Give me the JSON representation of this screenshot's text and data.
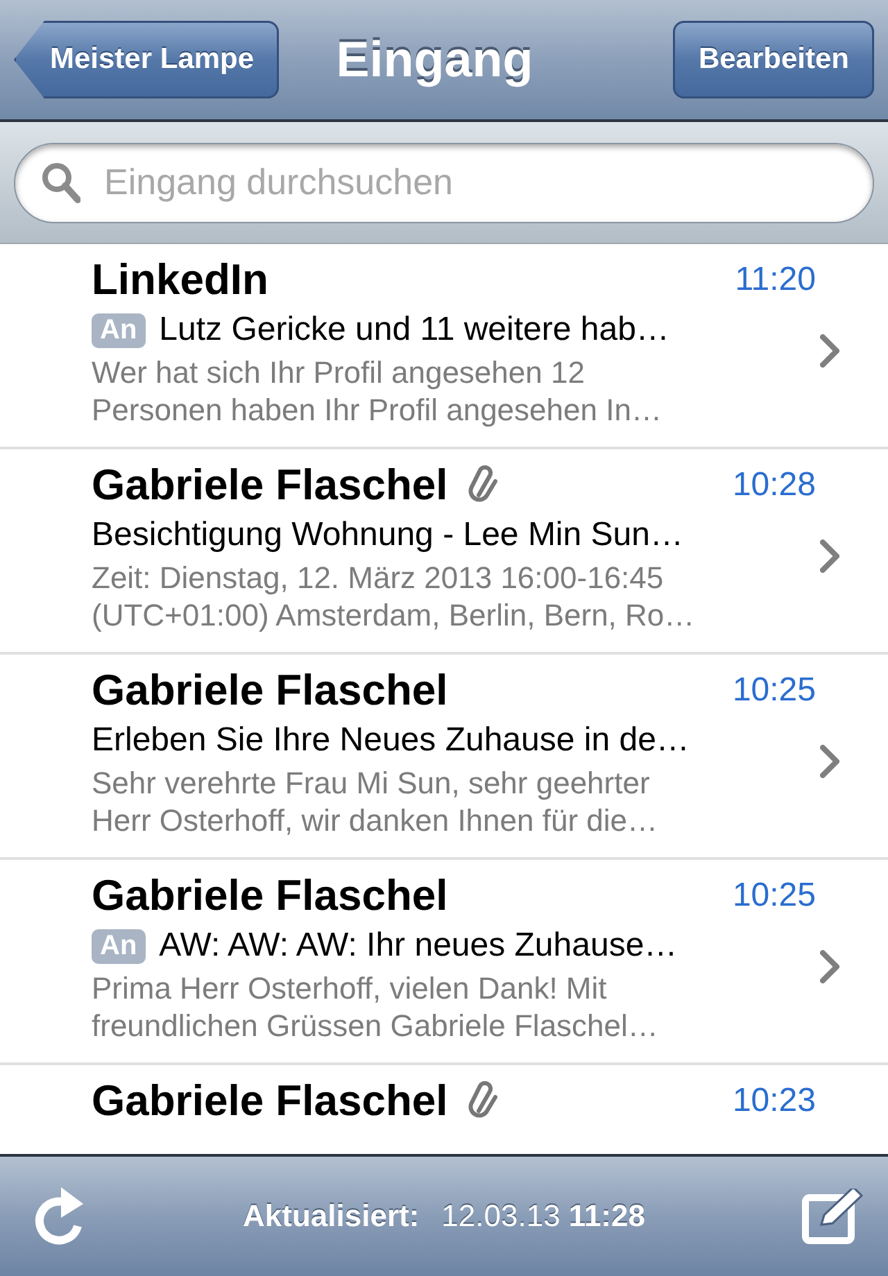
{
  "nav": {
    "back": "Meister Lampe",
    "title": "Eingang",
    "edit": "Bearbeiten"
  },
  "search": {
    "placeholder": "Eingang durchsuchen"
  },
  "messages": [
    {
      "sender": "LinkedIn",
      "time": "11:20",
      "attachment": false,
      "badge": "An",
      "subject": "Lutz Gericke und 11 weitere hab…",
      "preview": "Wer hat sich Ihr Profil angesehen 12 Personen haben Ihr Profil angesehen In…"
    },
    {
      "sender": "Gabriele Flaschel",
      "time": "10:28",
      "attachment": true,
      "subject": "Besichtigung Wohnung - Lee Min Sun…",
      "preview": "Zeit: Dienstag, 12. März 2013 16:00-16:45 (UTC+01:00) Amsterdam, Berlin, Bern, Ro…"
    },
    {
      "sender": "Gabriele Flaschel",
      "time": "10:25",
      "attachment": false,
      "subject": "Erleben Sie Ihre Neues Zuhause in de…",
      "preview": "Sehr verehrte Frau Mi Sun, sehr geehrter Herr Osterhoff, wir danken Ihnen für die…"
    },
    {
      "sender": "Gabriele Flaschel",
      "time": "10:25",
      "attachment": false,
      "badge": "An",
      "subject": "AW: AW: AW: Ihr neues Zuhause…",
      "preview": "Prima Herr Osterhoff, vielen Dank! Mit freundlichen Grüssen Gabriele Flaschel…"
    },
    {
      "sender": "Gabriele Flaschel",
      "time": "10:23",
      "attachment": true
    }
  ],
  "toolbar": {
    "label": "Aktualisiert:",
    "date": "12.03.13",
    "time": "11:28"
  }
}
